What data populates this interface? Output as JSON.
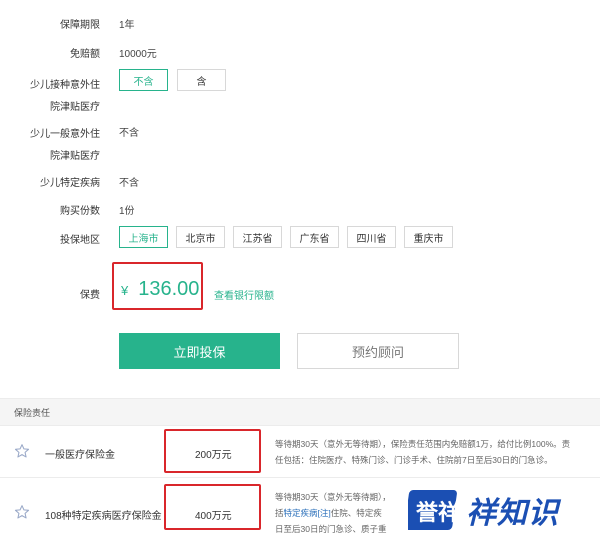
{
  "form": {
    "period_label": "保障期限",
    "period_value": "1年",
    "deductible_label": "免赔额",
    "deductible_value": "10000元",
    "vaccine_label_1": "少儿接种意外住",
    "vaccine_label_2": "院津贴医疗",
    "vaccine_options": [
      "不含",
      "含"
    ],
    "general_label_1": "少儿一般意外住",
    "general_label_2": "院津贴医疗",
    "general_value": "不含",
    "disease_label": "少儿特定疾病",
    "disease_value": "不含",
    "copies_label": "购买份数",
    "copies_value": "1份",
    "region_label": "投保地区",
    "regions": [
      "上海市",
      "北京市",
      "江苏省",
      "广东省",
      "四川省",
      "重庆市"
    ],
    "premium_label": "保费",
    "currency": "¥",
    "premium": "136.00",
    "bank_limit_link": "查看银行限额"
  },
  "actions": {
    "buy": "立即投保",
    "consult": "预约顾问"
  },
  "coverage": {
    "title": "保险责任",
    "rows": [
      {
        "name": "一般医疗保险金",
        "amount": "200万元",
        "desc_1": "等待期30天（意外无等待期），保险责任范围内免赔额1万，给付比例100%。责",
        "desc_2": "任包括：住院医疗、特殊门诊、门诊手术、住院前7日至后30日的门急诊。"
      },
      {
        "name": "108种特定疾病医疗保险金",
        "amount": "400万元",
        "desc_1": "等待期30天（意外无等待期），",
        "desc_2_pre": "括",
        "desc_2_hl": "特定疾病[注]",
        "desc_2_post": "住院、特定疾",
        "desc_3": "日至后30日的门急诊、质子重"
      }
    ]
  },
  "watermark": {
    "text": "祥知识",
    "logo_text": "誉祥"
  },
  "colors": {
    "accent": "#27b38c",
    "highlight_box": "#d9262b",
    "watermark": "#1b4fb3"
  }
}
